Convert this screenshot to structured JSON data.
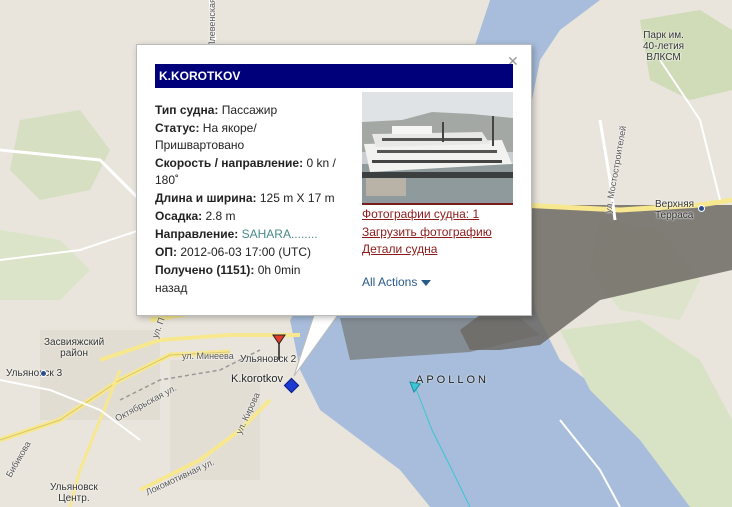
{
  "map": {
    "labels": {
      "park": "Парк им.\n40-летия\nВЛКСМ",
      "verkhnyaya_terrasa": "Верхняя\nТерраса",
      "zasviyazhsky": "Засвияжский\nрайон",
      "ulyanovsk2": "Ульяновск 2",
      "ulyanovsk3": "Ульяновск 3",
      "ulyanovsk_center": "Ульяновск\nЦентр.",
      "ul_mineeva": "ул. Минеева",
      "oktyabrskaya": "Октябрьская ул.",
      "lokomotivnaya": "Локомотивная ул.",
      "kirova": "ул. Кирова",
      "mostostroiteley": "ул. Мостостроителей",
      "plivenskaya": "Плевенская",
      "bibikova": "Бибикова",
      "ul_p": "ул. П"
    },
    "vessels": {
      "korotkov": "K.korotkov",
      "apollon": "APOLLON"
    },
    "colors": {
      "water": "#a7bddb",
      "land": "#e9e5dc",
      "road_yellow": "#f7e890",
      "vessel_selected": "#1b3ad1",
      "vessel_other": "#39c6d6"
    }
  },
  "popup": {
    "close_icon": "close-icon",
    "title": "K.KOROTKOV",
    "fields": {
      "type_label": "Тип судна:",
      "type_value": "Пассажир",
      "status_label": "Статус:",
      "status_value": "На якоре/Пришвартовано",
      "speed_label": "Скорость / направление:",
      "speed_value": "0 kn / 180˚",
      "dims_label": "Длина и ширина:",
      "dims_value": "125 m X 17 m",
      "draft_label": "Осадка:",
      "draft_value": "2.8 m",
      "dest_label": "Направление:",
      "dest_value": "SAHARA........",
      "op_label": "ОП:",
      "op_value": "2012-06-03 17:00 (UTC)",
      "received_label": "Получено (1151):",
      "received_value": "0h 0min",
      "received_overflow": "назад"
    },
    "links": {
      "photos": "Фотографии судна: 1",
      "upload": "Загрузить фотографию",
      "details": "Детали судна"
    },
    "actions_label": "All Actions"
  }
}
